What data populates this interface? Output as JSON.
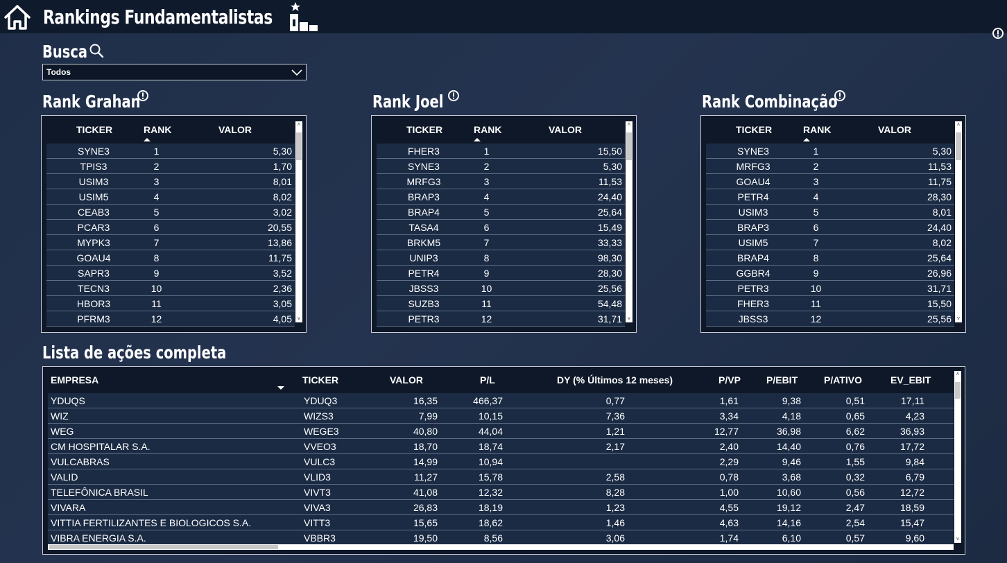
{
  "header": {
    "title": "Rankings Fundamentalistas"
  },
  "search": {
    "label": "Busca",
    "selected": "Todos"
  },
  "rank_grahan": {
    "title": "Rank Grahan",
    "columns": [
      "TICKER",
      "RANK",
      "VALOR"
    ],
    "rows": [
      [
        "SYNE3",
        "1",
        "5,30"
      ],
      [
        "TPIS3",
        "2",
        "1,70"
      ],
      [
        "USIM3",
        "3",
        "8,01"
      ],
      [
        "USIM5",
        "4",
        "8,02"
      ],
      [
        "CEAB3",
        "5",
        "3,02"
      ],
      [
        "PCAR3",
        "6",
        "20,55"
      ],
      [
        "MYPK3",
        "7",
        "13,86"
      ],
      [
        "GOAU4",
        "8",
        "11,75"
      ],
      [
        "SAPR3",
        "9",
        "3,52"
      ],
      [
        "TECN3",
        "10",
        "2,36"
      ],
      [
        "HBOR3",
        "11",
        "3,05"
      ],
      [
        "PFRM3",
        "12",
        "4,05"
      ]
    ]
  },
  "rank_joel": {
    "title": "Rank Joel",
    "columns": [
      "TICKER",
      "RANK",
      "VALOR"
    ],
    "rows": [
      [
        "FHER3",
        "1",
        "15,50"
      ],
      [
        "SYNE3",
        "2",
        "5,30"
      ],
      [
        "MRFG3",
        "3",
        "11,53"
      ],
      [
        "BRAP3",
        "4",
        "24,40"
      ],
      [
        "BRAP4",
        "5",
        "25,64"
      ],
      [
        "TASA4",
        "6",
        "15,49"
      ],
      [
        "BRKM5",
        "7",
        "33,33"
      ],
      [
        "UNIP3",
        "8",
        "98,30"
      ],
      [
        "PETR4",
        "9",
        "28,30"
      ],
      [
        "JBSS3",
        "10",
        "25,56"
      ],
      [
        "SUZB3",
        "11",
        "54,48"
      ],
      [
        "PETR3",
        "12",
        "31,71"
      ]
    ]
  },
  "rank_combinacao": {
    "title": "Rank Combinação",
    "columns": [
      "TICKER",
      "RANK",
      "VALOR"
    ],
    "rows": [
      [
        "SYNE3",
        "1",
        "5,30"
      ],
      [
        "MRFG3",
        "2",
        "11,53"
      ],
      [
        "GOAU4",
        "3",
        "11,75"
      ],
      [
        "PETR4",
        "4",
        "28,30"
      ],
      [
        "USIM3",
        "5",
        "8,01"
      ],
      [
        "BRAP3",
        "6",
        "24,40"
      ],
      [
        "USIM5",
        "7",
        "8,02"
      ],
      [
        "BRAP4",
        "8",
        "25,64"
      ],
      [
        "GGBR4",
        "9",
        "26,96"
      ],
      [
        "PETR3",
        "10",
        "31,71"
      ],
      [
        "FHER3",
        "11",
        "15,50"
      ],
      [
        "JBSS3",
        "12",
        "25,56"
      ]
    ]
  },
  "lista": {
    "title": "Lista de ações completa",
    "columns": [
      "EMPRESA",
      "TICKER",
      "VALOR",
      "P/L",
      "DY (% Últimos 12 meses)",
      "P/VP",
      "P/EBIT",
      "P/ATIVO",
      "EV_EBIT"
    ],
    "rows": [
      [
        "YDUQS",
        "YDUQ3",
        "16,35",
        "466,37",
        "0,77",
        "1,61",
        "9,38",
        "0,51",
        "17,11"
      ],
      [
        "WIZ",
        "WIZS3",
        "7,99",
        "10,15",
        "7,36",
        "3,34",
        "4,18",
        "0,65",
        "4,23"
      ],
      [
        "WEG",
        "WEGE3",
        "40,80",
        "44,04",
        "1,21",
        "12,77",
        "36,98",
        "6,62",
        "36,93"
      ],
      [
        "CM HOSPITALAR S.A.",
        "VVEO3",
        "18,70",
        "18,74",
        "2,17",
        "2,40",
        "14,40",
        "0,76",
        "17,72"
      ],
      [
        "VULCABRAS",
        "VULC3",
        "14,99",
        "10,94",
        "",
        "2,29",
        "9,46",
        "1,55",
        "9,84"
      ],
      [
        "VALID",
        "VLID3",
        "11,27",
        "15,78",
        "2,58",
        "0,78",
        "3,68",
        "0,32",
        "6,79"
      ],
      [
        "TELEFÔNICA BRASIL",
        "VIVT3",
        "41,08",
        "12,32",
        "8,28",
        "1,00",
        "10,60",
        "0,56",
        "12,72"
      ],
      [
        "VIVARA",
        "VIVA3",
        "26,83",
        "18,19",
        "1,23",
        "4,55",
        "19,12",
        "2,47",
        "18,59"
      ],
      [
        "VITTIA FERTILIZANTES E BIOLOGICOS S.A.",
        "VITT3",
        "15,65",
        "18,62",
        "1,46",
        "4,63",
        "14,16",
        "2,54",
        "15,47"
      ],
      [
        "VIBRA ENERGIA S.A.",
        "VBBR3",
        "19,50",
        "8,56",
        "3,06",
        "1,74",
        "6,10",
        "0,57",
        "9,60"
      ]
    ]
  },
  "colors": {
    "background": "#1f2e48",
    "topbar": "#0f1a2c",
    "card": "#0e1829",
    "row": "#1b2b44",
    "border": "#c9ced6"
  }
}
